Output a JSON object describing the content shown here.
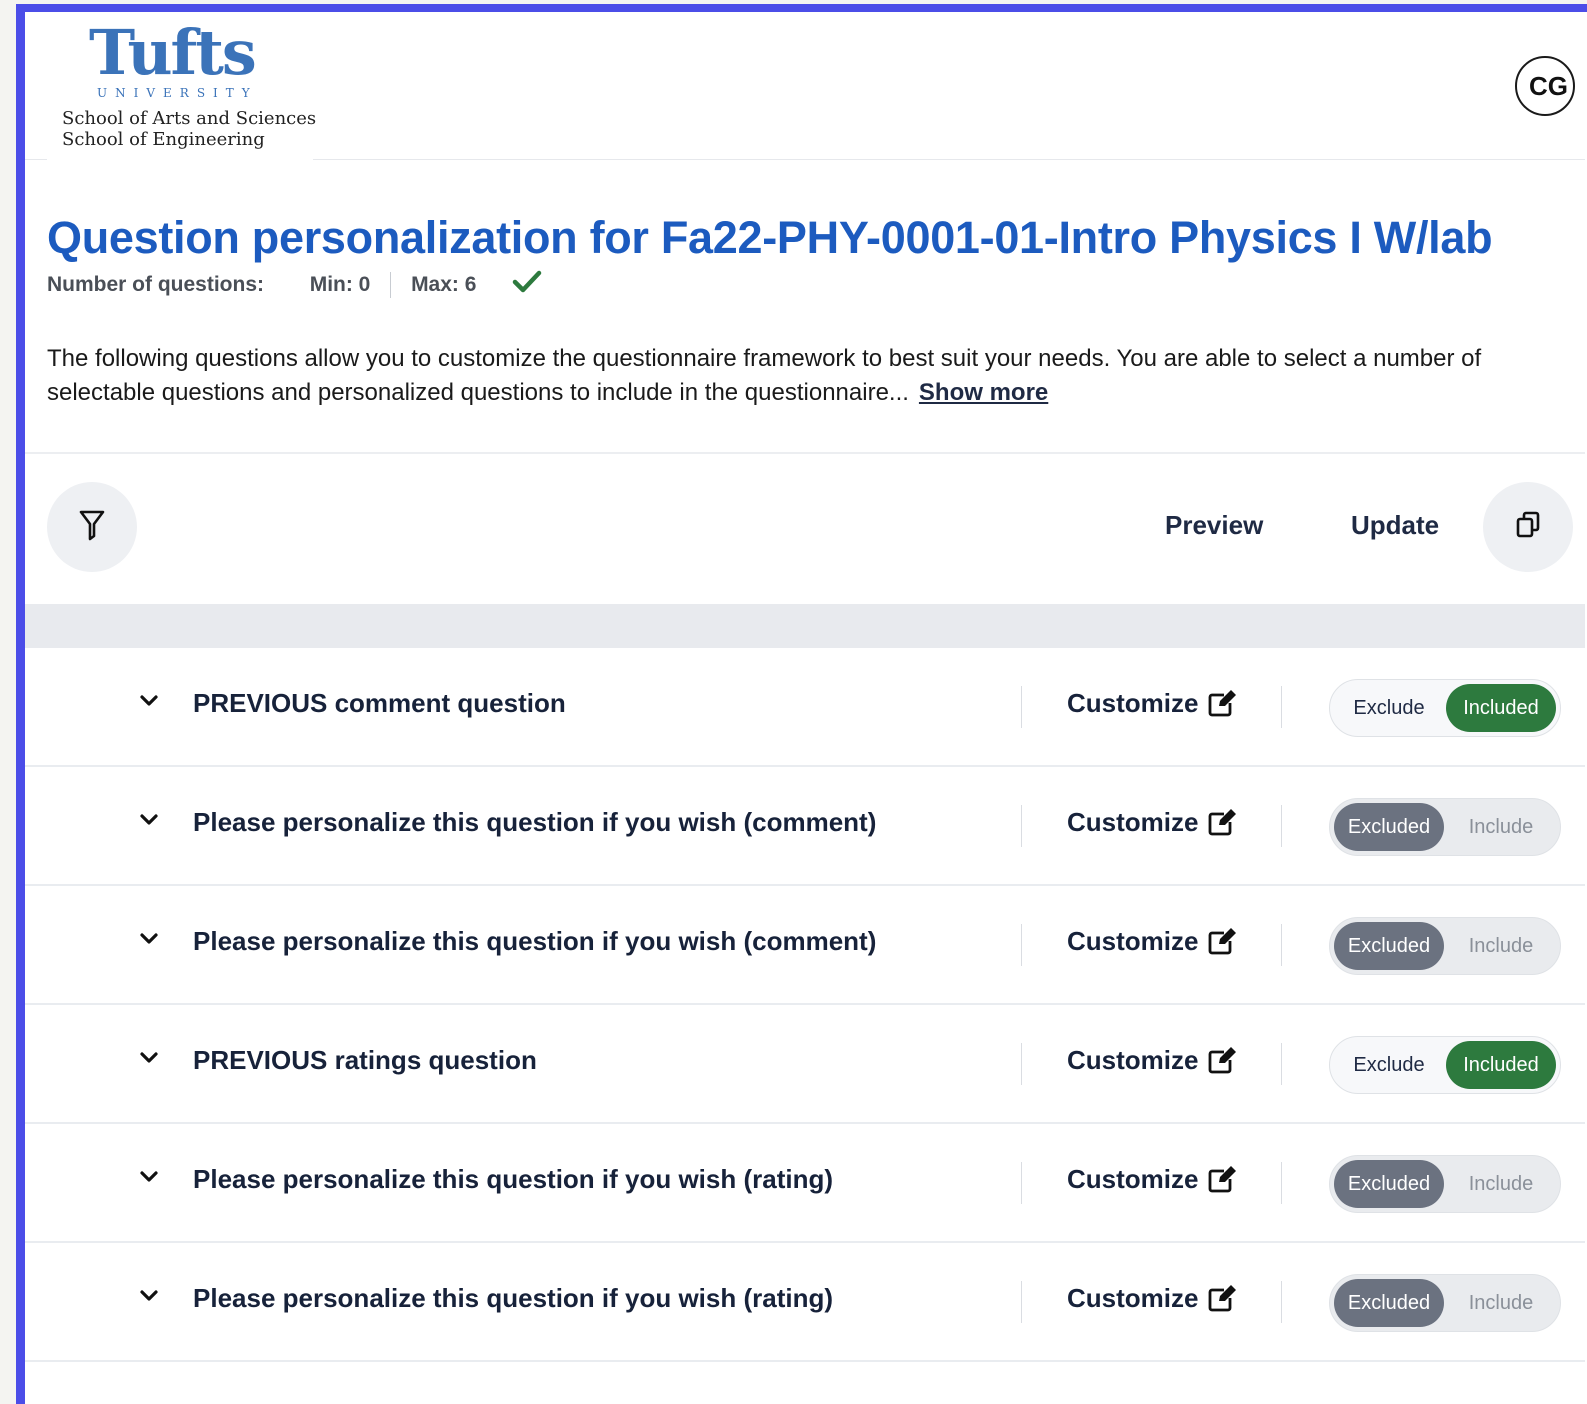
{
  "header": {
    "logo": {
      "wordmark": "Tufts",
      "subtitle": "UNIVERSITY",
      "schools": [
        "School of Arts and Sciences",
        "School of Engineering"
      ]
    },
    "avatar_initials": "CG"
  },
  "page": {
    "title": "Question personalization for Fa22-PHY-0001-01-Intro Physics I W/lab",
    "count_label": "Number of questions:",
    "min_label": "Min: 0",
    "max_label": "Max: 6",
    "description_line1": "The following questions allow you to customize the questionnaire framework to best suit your needs. You are able to select a number of",
    "description_line2": "selectable questions and personalized questions to include in the questionnaire...",
    "show_more": "Show more"
  },
  "toolbar": {
    "filter_icon": "filter-icon",
    "preview_label": "Preview",
    "update_label": "Update",
    "copy_icon": "copy-icon"
  },
  "colors": {
    "accent_border": "#4b4de8",
    "title_blue": "#1c5bbf",
    "included_green": "#2d7a3e",
    "excluded_gray": "#6b7280"
  },
  "customize_label": "Customize",
  "questions": [
    {
      "text": "PREVIOUS comment question",
      "state": "included",
      "left_label": "Exclude",
      "right_label": "Included"
    },
    {
      "text": "Please personalize this question if you wish (comment)",
      "state": "excluded",
      "left_label": "Excluded",
      "right_label": "Include"
    },
    {
      "text": "Please personalize this question if you wish (comment)",
      "state": "excluded",
      "left_label": "Excluded",
      "right_label": "Include"
    },
    {
      "text": "PREVIOUS ratings question",
      "state": "included",
      "left_label": "Exclude",
      "right_label": "Included"
    },
    {
      "text": "Please personalize this question if you wish (rating)",
      "state": "excluded",
      "left_label": "Excluded",
      "right_label": "Include"
    },
    {
      "text": "Please personalize this question if you wish (rating)",
      "state": "excluded",
      "left_label": "Excluded",
      "right_label": "Include"
    }
  ]
}
